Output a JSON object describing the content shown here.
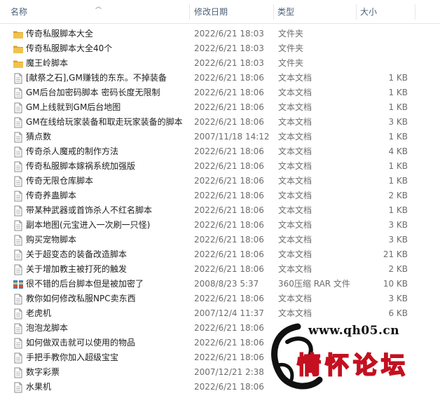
{
  "header": {
    "name": "名称",
    "date": "修改日期",
    "type": "类型",
    "size": "大小"
  },
  "rows": [
    {
      "icon": "folder",
      "name": "传奇私服脚本大全",
      "date": "2022/6/21 18:03",
      "type": "文件夹",
      "size": ""
    },
    {
      "icon": "folder",
      "name": "传奇私服脚本大全40个",
      "date": "2022/6/21 18:03",
      "type": "文件夹",
      "size": ""
    },
    {
      "icon": "folder",
      "name": "魔王岭脚本",
      "date": "2022/6/21 18:03",
      "type": "文件夹",
      "size": ""
    },
    {
      "icon": "doc",
      "name": "[献祭之石],GM赚钱的东东。不掉装备",
      "date": "2022/6/21 18:06",
      "type": "文本文档",
      "size": "1 KB"
    },
    {
      "icon": "doc",
      "name": "GM后台加密码脚本 密码长度无限制",
      "date": "2022/6/21 18:06",
      "type": "文本文档",
      "size": "1 KB"
    },
    {
      "icon": "doc",
      "name": "GM上线就到GM后台地图",
      "date": "2022/6/21 18:06",
      "type": "文本文档",
      "size": "1 KB"
    },
    {
      "icon": "doc",
      "name": "GM在线给玩家装备和取走玩家装备的脚本",
      "date": "2022/6/21 18:06",
      "type": "文本文档",
      "size": "3 KB"
    },
    {
      "icon": "doc",
      "name": "猜点数",
      "date": "2007/11/18 14:12",
      "type": "文本文档",
      "size": "1 KB"
    },
    {
      "icon": "doc",
      "name": "传奇杀人魔戒的制作方法",
      "date": "2022/6/21 18:06",
      "type": "文本文档",
      "size": "4 KB"
    },
    {
      "icon": "doc",
      "name": "传奇私服脚本嫁祸系统加强版",
      "date": "2022/6/21 18:06",
      "type": "文本文档",
      "size": "1 KB"
    },
    {
      "icon": "doc",
      "name": "传奇无限仓库脚本",
      "date": "2022/6/21 18:06",
      "type": "文本文档",
      "size": "1 KB"
    },
    {
      "icon": "doc",
      "name": "传奇养蛊脚本",
      "date": "2022/6/21 18:06",
      "type": "文本文档",
      "size": "2 KB"
    },
    {
      "icon": "doc",
      "name": "带某种武器或首饰杀人不红名脚本",
      "date": "2022/6/21 18:06",
      "type": "文本文档",
      "size": "1 KB"
    },
    {
      "icon": "doc",
      "name": "副本地图(元宝进入一次刷一只怪)",
      "date": "2022/6/21 18:06",
      "type": "文本文档",
      "size": "3 KB"
    },
    {
      "icon": "doc",
      "name": "购买宠物脚本",
      "date": "2022/6/21 18:06",
      "type": "文本文档",
      "size": "3 KB"
    },
    {
      "icon": "doc",
      "name": "关于超变态的装备改造脚本",
      "date": "2022/6/21 18:06",
      "type": "文本文档",
      "size": "21 KB"
    },
    {
      "icon": "doc",
      "name": "关于增加教主被打死的触发",
      "date": "2022/6/21 18:06",
      "type": "文本文档",
      "size": "2 KB"
    },
    {
      "icon": "rar",
      "name": "很不错的后台脚本但是被加密了",
      "date": "2008/8/23 5:37",
      "type": "360压缩 RAR 文件",
      "size": "10 KB"
    },
    {
      "icon": "doc",
      "name": "教你如何修改私服NPC卖东西",
      "date": "2022/6/21 18:06",
      "type": "文本文档",
      "size": "3 KB"
    },
    {
      "icon": "doc",
      "name": "老虎机",
      "date": "2007/12/4 11:37",
      "type": "文本文档",
      "size": "6 KB"
    },
    {
      "icon": "doc",
      "name": "泡泡龙脚本",
      "date": "2022/6/21 18:06",
      "type": "",
      "size": ""
    },
    {
      "icon": "doc",
      "name": "如何做双击就可以使用的物品",
      "date": "2022/6/21 18:06",
      "type": "",
      "size": ""
    },
    {
      "icon": "doc",
      "name": "手把手教你加入超级宝宝",
      "date": "2022/6/21 18:06",
      "type": "",
      "size": ""
    },
    {
      "icon": "doc",
      "name": "数字彩票",
      "date": "2007/12/21 2:38",
      "type": "",
      "size": ""
    },
    {
      "icon": "doc",
      "name": "水果机",
      "date": "2022/6/21 18:06",
      "type": "",
      "size": ""
    }
  ],
  "watermark": {
    "url": "www.qh05.cn",
    "title": "情怀论坛"
  },
  "colors": {
    "folder": "#f1c24d",
    "folder_dark": "#d9a126",
    "header_text": "#4c607a",
    "watermark_red": "#c41020"
  }
}
